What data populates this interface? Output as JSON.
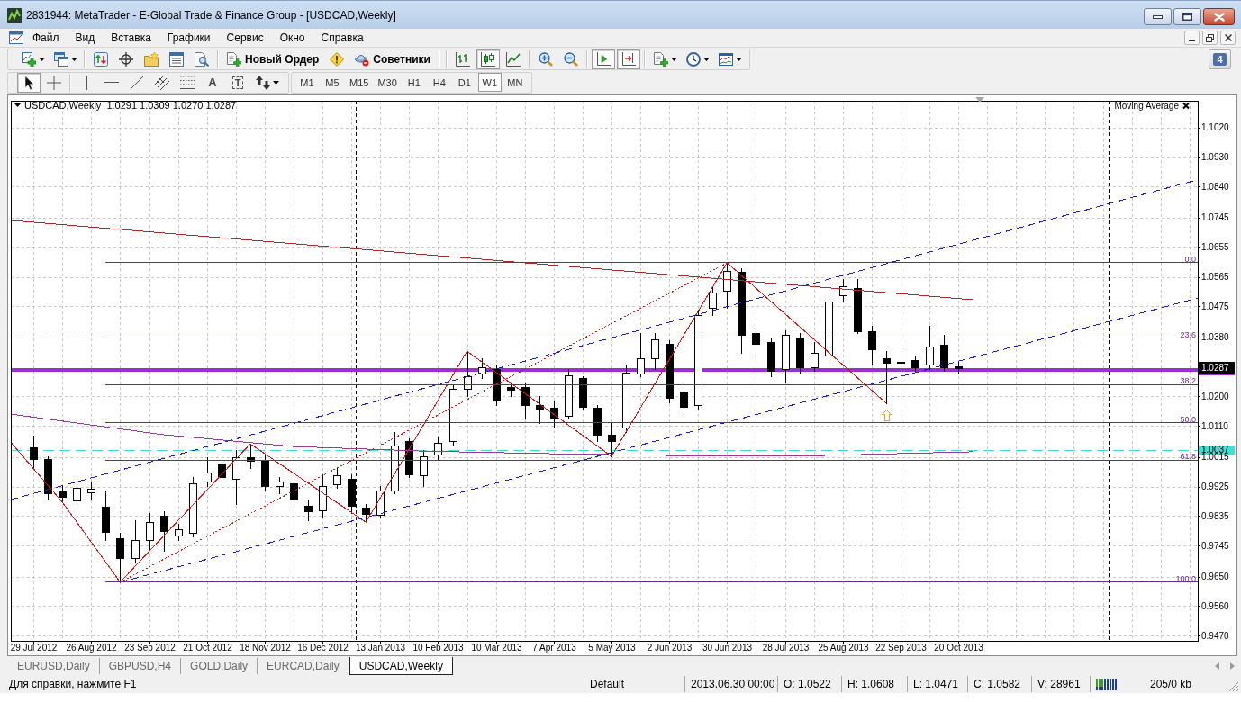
{
  "window": {
    "title": "2831944: MetaTrader - E-Global Trade & Finance Group - [USDCAD,Weekly]"
  },
  "menu": [
    "Файл",
    "Вид",
    "Вставка",
    "Графики",
    "Сервис",
    "Окно",
    "Справка"
  ],
  "toolbar_main": {
    "new_order": "Новый Ордер",
    "experts": "Советники",
    "chart_types": [
      {
        "kind": "bars",
        "selected": false
      },
      {
        "kind": "candles",
        "selected": true
      },
      {
        "kind": "line",
        "selected": false
      }
    ],
    "view_toggles": [
      {
        "kind": "auto_scroll",
        "on": true
      },
      {
        "kind": "chart_shift",
        "on": true
      }
    ],
    "notifications": "4"
  },
  "toolbar_tools": {
    "tools": [
      {
        "kind": "cursor",
        "selected": true
      },
      {
        "kind": "crosshair",
        "selected": false
      },
      {
        "kind": "vline",
        "selected": false
      },
      {
        "kind": "hline",
        "selected": false
      },
      {
        "kind": "trendline",
        "selected": false
      },
      {
        "kind": "channel",
        "selected": false
      },
      {
        "kind": "fibo",
        "selected": false
      },
      {
        "kind": "text",
        "label": "A",
        "selected": false
      },
      {
        "kind": "label",
        "label": "T",
        "selected": false
      },
      {
        "kind": "arrows",
        "selected": false
      }
    ],
    "timeframes": [
      {
        "label": "M1",
        "selected": false
      },
      {
        "label": "M5",
        "selected": false
      },
      {
        "label": "M15",
        "selected": false
      },
      {
        "label": "M30",
        "selected": false
      },
      {
        "label": "H1",
        "selected": false
      },
      {
        "label": "H4",
        "selected": false
      },
      {
        "label": "D1",
        "selected": false
      },
      {
        "label": "W1",
        "selected": true
      },
      {
        "label": "MN",
        "selected": false
      }
    ]
  },
  "chart": {
    "header": {
      "symbol": "USDCAD,Weekly",
      "values": "1.0291 1.0309 1.0270 1.0287"
    },
    "indicator_label": "Moving Average",
    "last_price": "1.0287",
    "chart_data": [
      {
        "type": "candlestick",
        "x": [
          "2012-07-29",
          "2012-08-05",
          "2012-08-12",
          "2012-08-19",
          "2012-08-26",
          "2012-09-02",
          "2012-09-09",
          "2012-09-16",
          "2012-09-23",
          "2012-09-30",
          "2012-10-07",
          "2012-10-14",
          "2012-10-21",
          "2012-10-28",
          "2012-11-04",
          "2012-11-11",
          "2012-11-18",
          "2012-11-25",
          "2012-12-02",
          "2012-12-09",
          "2012-12-16",
          "2012-12-23",
          "2012-12-30",
          "2013-01-06",
          "2013-01-13",
          "2013-01-20",
          "2013-01-27",
          "2013-02-03",
          "2013-02-10",
          "2013-02-17",
          "2013-02-24",
          "2013-03-03",
          "2013-03-10",
          "2013-03-17",
          "2013-03-24",
          "2013-03-31",
          "2013-04-07",
          "2013-04-14",
          "2013-04-21",
          "2013-04-28",
          "2013-05-05",
          "2013-05-12",
          "2013-05-19",
          "2013-05-26",
          "2013-06-02",
          "2013-06-09",
          "2013-06-16",
          "2013-06-23",
          "2013-06-30",
          "2013-07-07",
          "2013-07-14",
          "2013-07-21",
          "2013-07-28",
          "2013-08-04",
          "2013-08-11",
          "2013-08-18",
          "2013-08-25",
          "2013-09-01",
          "2013-09-08",
          "2013-09-15",
          "2013-09-22",
          "2013-09-29",
          "2013-10-06",
          "2013-10-13",
          "2013-10-20"
        ],
        "ohlc": [
          [
            1.0045,
            1.008,
            0.9981,
            1.0009
          ],
          [
            1.0009,
            1.0017,
            0.9885,
            0.9904
          ],
          [
            0.991,
            0.9926,
            0.9877,
            0.9893
          ],
          [
            0.9882,
            0.9932,
            0.9871,
            0.9921
          ],
          [
            0.9907,
            0.994,
            0.9885,
            0.9918
          ],
          [
            0.9863,
            0.9913,
            0.9761,
            0.9786
          ],
          [
            0.9767,
            0.9783,
            0.9633,
            0.9706
          ],
          [
            0.9706,
            0.9822,
            0.9692,
            0.9761
          ],
          [
            0.9761,
            0.9844,
            0.9734,
            0.9816
          ],
          [
            0.9835,
            0.9849,
            0.9728,
            0.9789
          ],
          [
            0.9775,
            0.9811,
            0.9761,
            0.9794
          ],
          [
            0.9783,
            0.9954,
            0.9772,
            0.9935
          ],
          [
            0.994,
            1.0014,
            0.9926,
            0.9968
          ],
          [
            0.9995,
            1.0014,
            0.994,
            0.9954
          ],
          [
            0.9948,
            1.0036,
            0.9871,
            1.0014
          ],
          [
            1.0014,
            1.0055,
            0.9981,
            1.0003
          ],
          [
            1.0003,
            1.0022,
            0.9913,
            0.9926
          ],
          [
            0.9926,
            0.9954,
            0.9904,
            0.994
          ],
          [
            0.9935,
            0.9954,
            0.9871,
            0.9885
          ],
          [
            0.9866,
            0.9885,
            0.9822,
            0.9849
          ],
          [
            0.9852,
            0.9962,
            0.983,
            0.9926
          ],
          [
            0.9932,
            0.9981,
            0.9921,
            0.9959
          ],
          [
            0.9948,
            0.9962,
            0.9844,
            0.9866
          ],
          [
            0.986,
            0.9871,
            0.9816,
            0.9841
          ],
          [
            0.9838,
            0.9926,
            0.983,
            0.9913
          ],
          [
            0.9913,
            1.0091,
            0.9904,
            1.005
          ],
          [
            1.0064,
            1.0072,
            0.9954,
            0.9962
          ],
          [
            0.9959,
            1.0036,
            0.9926,
            1.0017
          ],
          [
            1.0022,
            1.0077,
            1.0009,
            1.0058
          ],
          [
            1.0064,
            1.0234,
            1.005,
            1.0223
          ],
          [
            1.0223,
            1.0338,
            1.0201,
            1.0262
          ],
          [
            1.027,
            1.0316,
            1.0256,
            1.0289
          ],
          [
            1.0284,
            1.0297,
            1.0174,
            1.0187
          ],
          [
            1.0229,
            1.0242,
            1.0201,
            1.022
          ],
          [
            1.0229,
            1.0242,
            1.0133,
            1.0174
          ],
          [
            1.0174,
            1.0201,
            1.0119,
            1.0163
          ],
          [
            1.0165,
            1.0187,
            1.0105,
            1.0133
          ],
          [
            1.0141,
            1.0284,
            1.0133,
            1.0264
          ],
          [
            1.0256,
            1.0262,
            1.016,
            1.0168
          ],
          [
            1.0165,
            1.0174,
            1.0064,
            1.0083
          ],
          [
            1.0083,
            1.0119,
            1.0017,
            1.0064
          ],
          [
            1.0105,
            1.0297,
            1.0091,
            1.0273
          ],
          [
            1.027,
            1.0393,
            1.0262,
            1.0316
          ],
          [
            1.0316,
            1.0393,
            1.0284,
            1.0374
          ],
          [
            1.036,
            1.0371,
            1.0182,
            1.0196
          ],
          [
            1.0215,
            1.0229,
            1.0146,
            1.0168
          ],
          [
            1.0174,
            1.0462,
            1.016,
            1.0448
          ],
          [
            1.047,
            1.0536,
            1.0448,
            1.0517
          ],
          [
            1.0522,
            1.0608,
            1.0471,
            1.0582
          ],
          [
            1.058,
            1.0591,
            1.0333,
            1.0388
          ],
          [
            1.0393,
            1.0415,
            1.0327,
            1.036
          ],
          [
            1.0366,
            1.038,
            1.0262,
            1.0278
          ],
          [
            1.0284,
            1.0402,
            1.0242,
            1.0388
          ],
          [
            1.038,
            1.0393,
            1.027,
            1.0289
          ],
          [
            1.0289,
            1.0366,
            1.0278,
            1.0333
          ],
          [
            1.0325,
            1.0567,
            1.0311,
            1.0489
          ],
          [
            1.0509,
            1.0558,
            1.0489,
            1.0536
          ],
          [
            1.0531,
            1.0558,
            1.0393,
            1.0399
          ],
          [
            1.0399,
            1.0415,
            1.0297,
            1.0344
          ],
          [
            1.0316,
            1.0338,
            1.018,
            1.0302
          ],
          [
            1.0305,
            1.0352,
            1.0273,
            1.0302
          ],
          [
            1.0311,
            1.0325,
            1.0278,
            1.0289
          ],
          [
            1.0297,
            1.0415,
            1.0284,
            1.0352
          ],
          [
            1.0357,
            1.0388,
            1.0278,
            1.0289
          ],
          [
            1.0291,
            1.0309,
            1.027,
            1.0287
          ]
        ],
        "xlim": [
          "2012-07-18",
          "2014-02-13"
        ],
        "ylim": [
          0.9454,
          1.1102
        ],
        "xticks": [
          {
            "value": "2012-07-29",
            "label": "29 Jul 2012"
          },
          {
            "value": "2012-08-26",
            "label": "26 Aug 2012"
          },
          {
            "value": "2012-09-23",
            "label": "23 Sep 2012"
          },
          {
            "value": "2012-10-21",
            "label": "21 Oct 2012"
          },
          {
            "value": "2012-11-18",
            "label": "18 Nov 2012"
          },
          {
            "value": "2012-12-16",
            "label": "16 Dec 2012"
          },
          {
            "value": "2013-01-13",
            "label": "13 Jan 2013"
          },
          {
            "value": "2013-02-10",
            "label": "10 Feb 2013"
          },
          {
            "value": "2013-03-10",
            "label": "10 Mar 2013"
          },
          {
            "value": "2013-04-07",
            "label": "7 Apr 2013"
          },
          {
            "value": "2013-05-05",
            "label": "5 May 2013"
          },
          {
            "value": "2013-06-02",
            "label": "2 Jun 2013"
          },
          {
            "value": "2013-06-30",
            "label": "30 Jun 2013"
          },
          {
            "value": "2013-07-28",
            "label": "28 Jul 2013"
          },
          {
            "value": "2013-08-25",
            "label": "25 Aug 2013"
          },
          {
            "value": "2013-09-22",
            "label": "22 Sep 2013"
          },
          {
            "value": "2013-10-20",
            "label": "20 Oct 2013"
          }
        ],
        "yticks": [
          {
            "value": 1.102,
            "label": "1.1020"
          },
          {
            "value": 1.093,
            "label": "1.0930"
          },
          {
            "value": 1.084,
            "label": "1.0840"
          },
          {
            "value": 1.0745,
            "label": "1.0745"
          },
          {
            "value": 1.0655,
            "label": "1.0655"
          },
          {
            "value": 1.0565,
            "label": "1.0565"
          },
          {
            "value": 1.0475,
            "label": "1.0475"
          },
          {
            "value": 1.038,
            "label": "1.0380"
          },
          {
            "value": 1.02,
            "label": "1.0200"
          },
          {
            "value": 1.011,
            "label": "1.0110"
          },
          {
            "value": 1.0015,
            "label": "1.0015"
          },
          {
            "value": 0.9925,
            "label": "0.9925"
          },
          {
            "value": 0.9835,
            "label": "0.9835"
          },
          {
            "value": 0.9745,
            "label": "0.9745"
          },
          {
            "value": 0.965,
            "label": "0.9650"
          },
          {
            "value": 0.956,
            "label": "0.9560"
          },
          {
            "value": 0.947,
            "label": "0.9470"
          }
        ],
        "grid": true,
        "series": [
          {
            "type": "line",
            "color": "#9a3a9a",
            "x": [
              "2012-07-18",
              "2012-09-30",
              "2012-12-02",
              "2013-02-03",
              "2013-04-07",
              "2013-06-09",
              "2013-08-11",
              "2013-10-27"
            ],
            "values": [
              1.0146,
              1.0083,
              1.0047,
              1.0033,
              1.0025,
              1.0019,
              1.0019,
              1.0031
            ]
          },
          {
            "type": "line",
            "color": "#b02828",
            "x": [
              "2012-07-18",
              "2013-03-10",
              "2013-10-27"
            ],
            "values": [
              1.0737,
              1.0615,
              1.0495
            ]
          },
          {
            "type": "line",
            "color": "#e01010",
            "x": [
              "2012-07-18",
              "2012-08-12",
              "2012-09-09",
              "2012-11-11",
              "2013-01-06",
              "2013-02-24",
              "2013-05-05",
              "2013-06-30",
              "2013-09-15"
            ],
            "values": [
              1.006,
              0.9877,
              0.9633,
              1.0055,
              0.9816,
              1.0338,
              1.0017,
              1.0608,
              1.018
            ]
          },
          {
            "type": "line",
            "color": "#e01010",
            "line_style": "dotted",
            "x": [
              "2012-09-09",
              "2013-06-30"
            ],
            "values": [
              0.9633,
              1.0608
            ]
          },
          {
            "type": "line",
            "color": "#1a1ad0",
            "line_style": "dashed",
            "x": [
              "2012-07-18",
              "2014-02-13"
            ],
            "values": [
              0.9885,
              1.0861
            ]
          },
          {
            "type": "line",
            "color": "#1a1ad0",
            "line_style": "dashed",
            "x": [
              "2012-09-09",
              "2014-02-13"
            ],
            "values": [
              0.9633,
              1.05
            ]
          },
          {
            "type": "line",
            "name": "0.0",
            "color": "#6a2a8a",
            "x": [
              "2012-09-02",
              "2014-02-13"
            ],
            "values": [
              1.0608,
              1.0608
            ]
          },
          {
            "type": "line",
            "name": "23.6",
            "color": "#6a2a8a",
            "x": [
              "2012-09-02",
              "2014-02-13"
            ],
            "values": [
              1.0378,
              1.0378
            ]
          },
          {
            "type": "line",
            "name": "38.2",
            "color": "#6a2a8a",
            "x": [
              "2012-09-02",
              "2014-02-13"
            ],
            "values": [
              1.0236,
              1.0236
            ]
          },
          {
            "type": "line",
            "name": "50.0",
            "color": "#6a2a8a",
            "x": [
              "2012-09-02",
              "2014-02-13"
            ],
            "values": [
              1.012,
              1.012
            ]
          },
          {
            "type": "line",
            "name": "61.8",
            "color": "#6a2a8a",
            "x": [
              "2012-09-02",
              "2014-02-13"
            ],
            "values": [
              1.0005,
              1.0005
            ]
          },
          {
            "type": "line",
            "name": "100.0",
            "color": "#6a2a8a",
            "x": [
              "2012-09-02",
              "2014-02-13"
            ],
            "values": [
              0.9633,
              0.9633
            ]
          }
        ],
        "ref_lines": [
          {
            "axis": "x",
            "value": "2013-01-01",
            "color": "#000000",
            "line_style": "dashed"
          },
          {
            "axis": "x",
            "value": "2014-01-01",
            "color": "#000000",
            "line_style": "dashed"
          },
          {
            "axis": "y",
            "value": 1.0284,
            "color": "#9b30d0"
          },
          {
            "axis": "y",
            "value": 1.0277,
            "color": "#9b30d0"
          },
          {
            "axis": "y",
            "value": 1.0037,
            "label": "1.0037",
            "color": "#40e0d0",
            "line_style": "dashed"
          }
        ]
      }
    ]
  },
  "chart_tabs": [
    {
      "label": "EURUSD,Daily",
      "selected": false
    },
    {
      "label": "GBPUSD,H4",
      "selected": false
    },
    {
      "label": "GOLD,Daily",
      "selected": false
    },
    {
      "label": "EURCAD,Daily",
      "selected": false
    },
    {
      "label": "USDCAD,Weekly",
      "selected": true
    }
  ],
  "status_bar": {
    "help": "Для справки, нажмите F1",
    "profile": "Default",
    "time": "2013.06.30 00:00",
    "open": "O: 1.0522",
    "high": "H: 1.0608",
    "low": "L: 1.0471",
    "close": "C: 1.0582",
    "volume": "V: 28961",
    "traffic": "205/0 kb"
  }
}
